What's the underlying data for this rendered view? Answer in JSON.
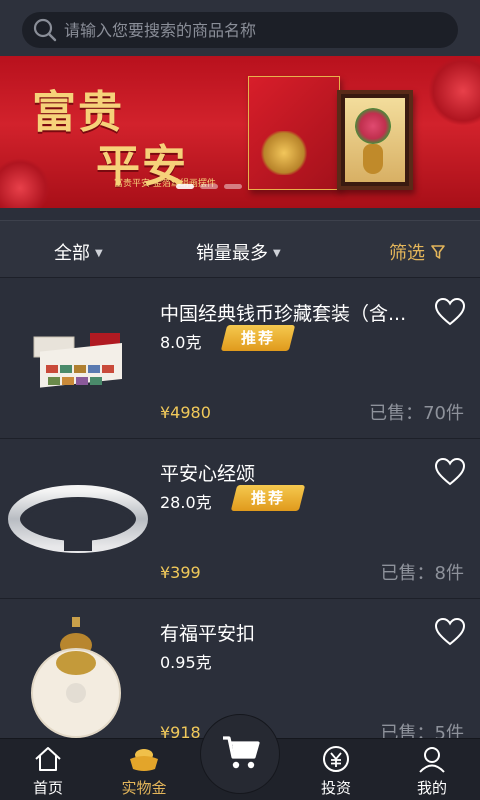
{
  "search": {
    "placeholder": "请输入您要搜索的商品名称"
  },
  "banner": {
    "title_line1": "富贵",
    "title_line2": "平安",
    "subtitle": "富贵平安·金箔丝绢画摆件",
    "slide_count": 3,
    "active_slide": 1
  },
  "filters": {
    "all": "全部",
    "sort": "销量最多",
    "filter": "筛选"
  },
  "products": [
    {
      "name": "中国经典钱币珍藏套装（含...",
      "weight": "8.0克",
      "badge": "推荐",
      "price": "¥4980",
      "sold": "已售：70件",
      "favorite": false
    },
    {
      "name": "平安心经颂",
      "weight": "28.0克",
      "badge": "推荐",
      "price": "¥399",
      "sold": "已售：8件",
      "favorite": false
    },
    {
      "name": "有福平安扣",
      "weight": "0.95克",
      "badge": "",
      "price": "¥918",
      "sold": "已售：5件",
      "favorite": false
    }
  ],
  "tabs": [
    {
      "label": "首页",
      "icon": "home-icon",
      "active": false
    },
    {
      "label": "实物金",
      "icon": "gold-ingot-icon",
      "active": true
    },
    {
      "label": "投资",
      "icon": "yuan-coin-icon",
      "active": false
    },
    {
      "label": "我的",
      "icon": "user-icon",
      "active": false
    }
  ],
  "colors": {
    "accent": "#e3b55a",
    "price": "#f1c95a",
    "background": "#2b2f3a",
    "badge": "#f0b030"
  }
}
